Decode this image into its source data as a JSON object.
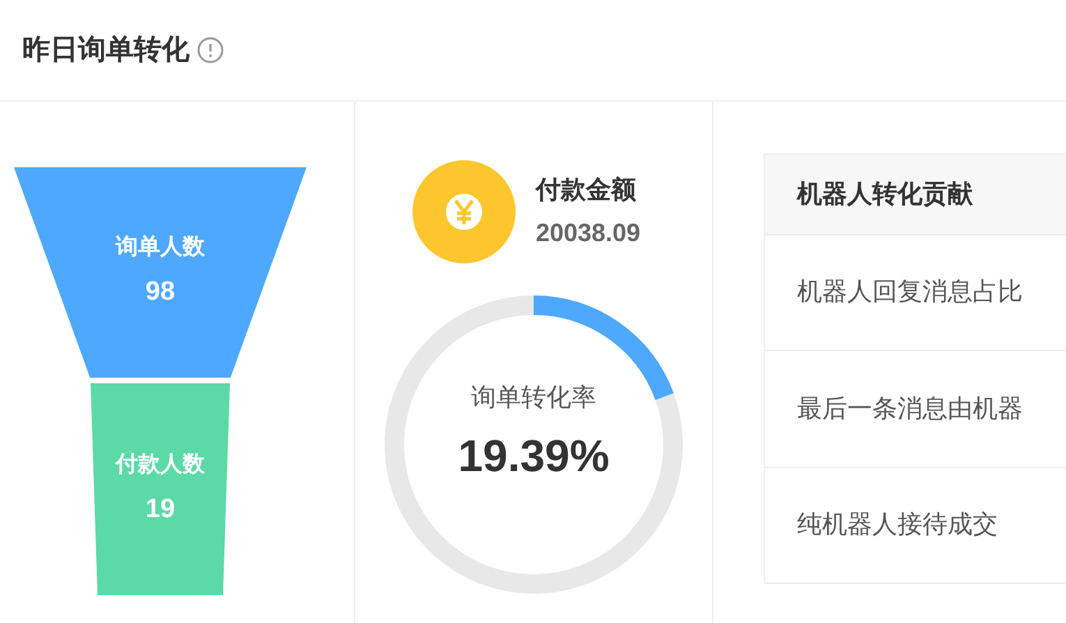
{
  "title": "昨日询单转化",
  "funnel": [
    {
      "label": "询单人数",
      "value": "98",
      "color": "#4da8fe"
    },
    {
      "label": "付款人数",
      "value": "19",
      "color": "#5bd9a6"
    }
  ],
  "payment": {
    "label": "付款金额",
    "amount": "20038.09"
  },
  "conversion": {
    "label": "询单转化率",
    "value": "19.39%",
    "level": 0.1939
  },
  "contribution": {
    "title": "机器人转化贡献",
    "rows": [
      "机器人回复消息占比",
      "最后一条消息由机器",
      "纯机器人接待成交"
    ]
  }
}
